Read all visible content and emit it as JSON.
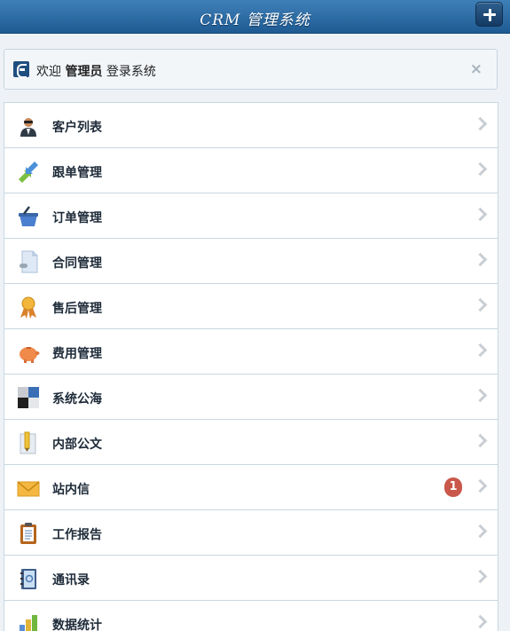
{
  "header": {
    "title": "CRM 管理系统"
  },
  "welcome": {
    "prefix": "欢迎",
    "user": "管理员",
    "suffix": "登录系统",
    "close_label": "×"
  },
  "menu": {
    "items": [
      {
        "label": "客户列表",
        "icon": "customer-icon"
      },
      {
        "label": "跟单管理",
        "icon": "follow-up-arrows-icon"
      },
      {
        "label": "订单管理",
        "icon": "shopping-basket-icon"
      },
      {
        "label": "合同管理",
        "icon": "contract-document-icon"
      },
      {
        "label": "售后管理",
        "icon": "award-ribbon-icon"
      },
      {
        "label": "费用管理",
        "icon": "piggy-bank-icon"
      },
      {
        "label": "系统公海",
        "icon": "squares-icon"
      },
      {
        "label": "内部公文",
        "icon": "document-pencil-icon"
      },
      {
        "label": "站内信",
        "icon": "envelope-icon",
        "badge": "1"
      },
      {
        "label": "工作报告",
        "icon": "clipboard-icon"
      },
      {
        "label": "通讯录",
        "icon": "address-book-icon"
      },
      {
        "label": "数据统计",
        "icon": "bar-chart-icon"
      }
    ]
  },
  "colors": {
    "header_top": "#3f80b8",
    "header_bottom": "#1f5a92",
    "badge": "#c9574a"
  }
}
